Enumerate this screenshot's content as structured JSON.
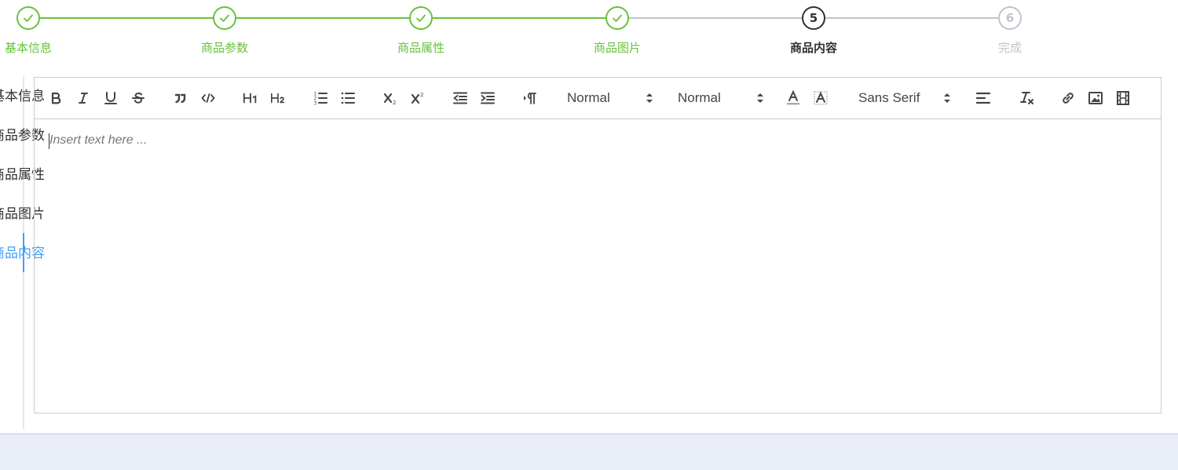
{
  "steps": [
    {
      "label": "基本信息",
      "status": "done"
    },
    {
      "label": "商品参数",
      "status": "done"
    },
    {
      "label": "商品属性",
      "status": "done"
    },
    {
      "label": "商品图片",
      "status": "done"
    },
    {
      "label": "商品内容",
      "status": "active",
      "number": "5"
    },
    {
      "label": "完成",
      "status": "wait",
      "number": "6"
    }
  ],
  "tabs": {
    "items": [
      "基本信息",
      "商品参数",
      "商品属性",
      "商品图片",
      "商品内容"
    ],
    "active": "商品内容"
  },
  "editor": {
    "toolbar": {
      "header1": "H1",
      "header2": "H2",
      "size_select": "Normal",
      "header_select": "Normal",
      "font_select": "Sans Serif"
    },
    "placeholder": "Insert text here ..."
  },
  "colors": {
    "success": "#67c23a",
    "active": "#303133",
    "wait": "#c0c4cc",
    "primary": "#409eff",
    "band": "#e9eef9"
  }
}
